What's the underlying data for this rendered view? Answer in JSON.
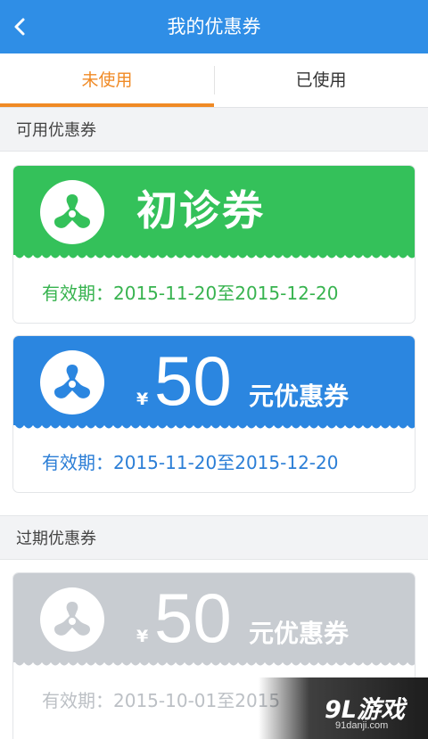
{
  "nav": {
    "title": "我的优惠券",
    "back_icon": "chevron-left-icon"
  },
  "tabs": [
    {
      "label": "未使用",
      "active": true
    },
    {
      "label": "已使用",
      "active": false
    }
  ],
  "sections": [
    {
      "title": "可用优惠券",
      "coupons": [
        {
          "name": "初诊券",
          "color": "#34c15a",
          "validity": "有效期：2015-11-20至2015-12-20",
          "validity_color": "#37b34f"
        },
        {
          "yen": "¥",
          "amount": "50",
          "unit": "元优惠券",
          "color": "#2b86e0",
          "validity": "有效期：2015-11-20至2015-12-20",
          "validity_color": "#2b7ed6"
        }
      ]
    },
    {
      "title": "过期优惠券",
      "coupons": [
        {
          "yen": "¥",
          "amount": "50",
          "unit": "元优惠券",
          "color": "#c8ccd1",
          "validity": "有效期：2015-10-01至2015",
          "validity_color": "#bcc0c5"
        }
      ]
    }
  ],
  "watermark": {
    "brand": "9L游戏",
    "site": "91danji.com"
  },
  "colors": {
    "nav": "#2f8ee6",
    "accent": "#f08a25",
    "background": "#f2f3f5"
  },
  "logo_icon": "hospital-logo-icon"
}
